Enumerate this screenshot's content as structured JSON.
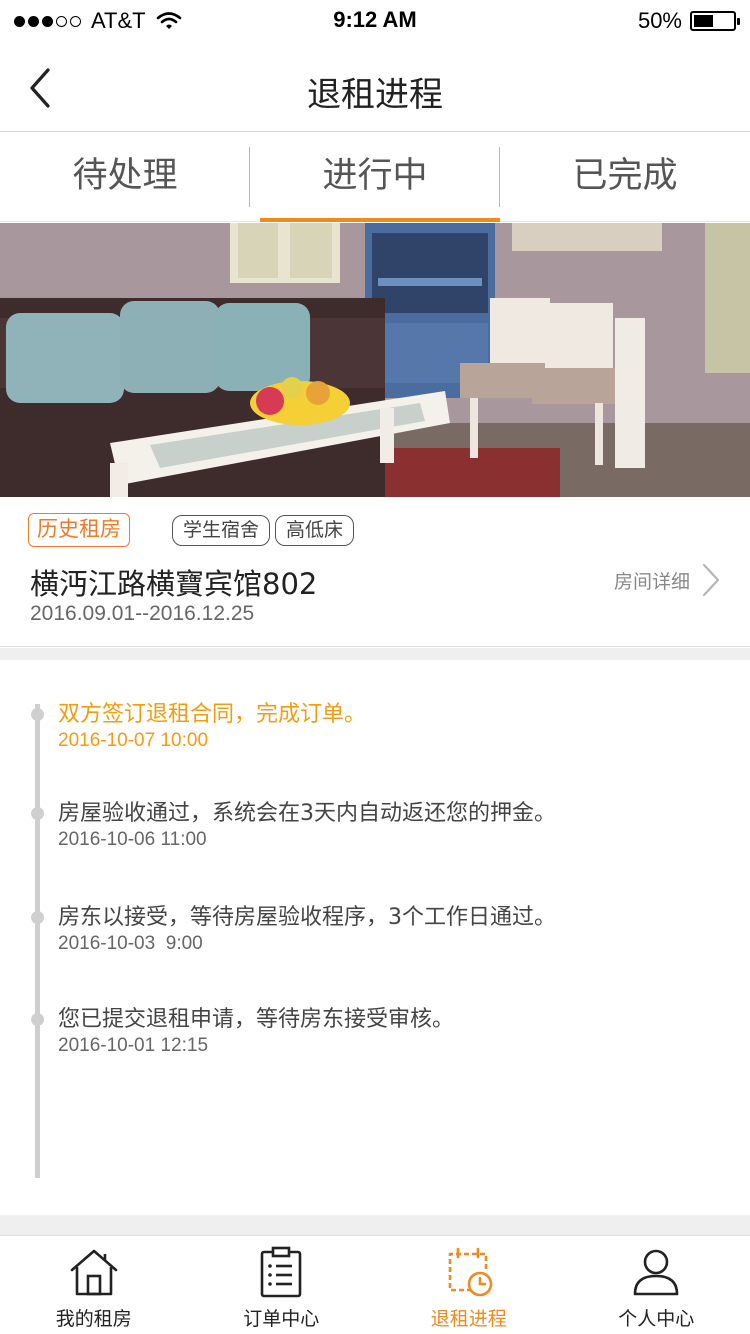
{
  "status_bar": {
    "carrier": "AT&T",
    "time": "9:12 AM",
    "battery_text": "50%",
    "battery_level": 0.5,
    "signal_bars_filled": 3,
    "signal_bars_total": 5
  },
  "header": {
    "title": "退租进程",
    "back_icon": "chevron-left-icon"
  },
  "tabs": [
    {
      "label": "待处理",
      "active": false
    },
    {
      "label": "进行中",
      "active": true
    },
    {
      "label": "已完成",
      "active": false
    }
  ],
  "accent_color": "#f08a1e",
  "room": {
    "history_badge": "历史租房",
    "tags": [
      "学生宿舍",
      "高低床"
    ],
    "title": "横沔江路横寶宾馆802",
    "dates": "2016.09.01--2016.12.25",
    "detail_link": "房间详细"
  },
  "timeline": [
    {
      "text": "双方签订退租合同，完成订单。",
      "time": "2016-10-07 10:00",
      "current": true
    },
    {
      "text": "房屋验收通过，系统会在3天内自动返还您的押金。",
      "time": "2016-10-06 11:00",
      "current": false
    },
    {
      "text": "房东以接受，等待房屋验收程序，3个工作日通过。",
      "time": "2016-10-03  9:00",
      "current": false
    },
    {
      "text": "您已提交退租申请，等待房东接受审核。",
      "time": "2016-10-01 12:15",
      "current": false
    }
  ],
  "tabbar": [
    {
      "label": "我的租房",
      "icon": "house-icon",
      "active": false
    },
    {
      "label": "订单中心",
      "icon": "clipboard-list-icon",
      "active": false
    },
    {
      "label": "退租进程",
      "icon": "calendar-clock-icon",
      "active": true
    },
    {
      "label": "个人中心",
      "icon": "person-icon",
      "active": false
    }
  ]
}
